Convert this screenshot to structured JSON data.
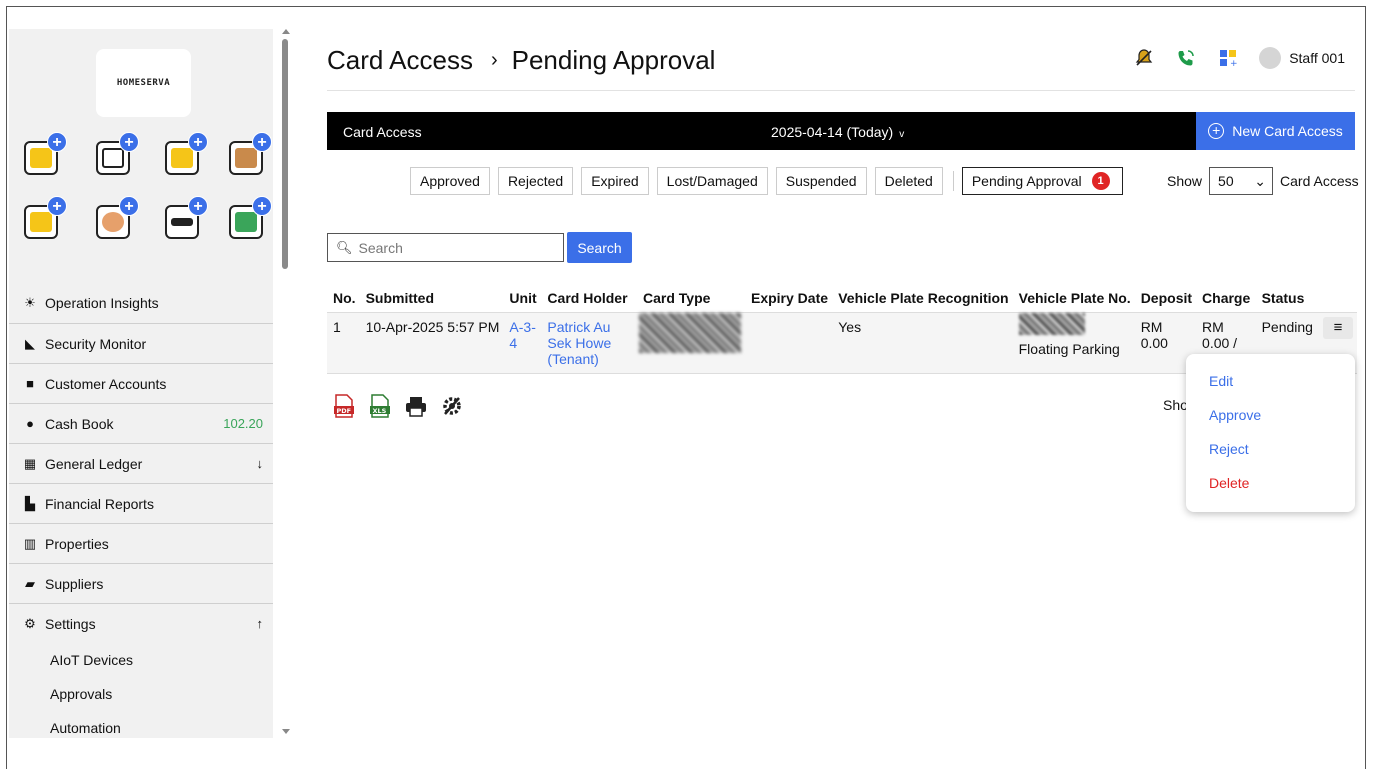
{
  "sidebar": {
    "logo_text": "HOMESERVA",
    "quick_icons": [
      {
        "name": "id-card-add-icon",
        "color": "#f5c518"
      },
      {
        "name": "calendar-add-icon",
        "color": "#222222"
      },
      {
        "name": "bank-add-icon",
        "color": "#f5c518"
      },
      {
        "name": "facilities-add-icon",
        "color": "#8b5a2b"
      },
      {
        "name": "key-card-add-icon",
        "color": "#f5c518"
      },
      {
        "name": "visitor-add-icon",
        "color": "#e6a06b"
      },
      {
        "name": "plate-number-add-icon",
        "color": "#222222"
      },
      {
        "name": "login-card-add-icon",
        "color": "#3aa55a"
      }
    ],
    "nav": [
      {
        "label": "Operation Insights",
        "icon": "lightbulb-icon"
      },
      {
        "label": "Security Monitor",
        "icon": "cctv-icon"
      },
      {
        "label": "Customer Accounts",
        "icon": "user-card-icon"
      },
      {
        "label": "Cash Book",
        "icon": "dollar-icon",
        "right": "102.20"
      },
      {
        "label": "General Ledger",
        "icon": "calculator-icon",
        "right": "↓"
      },
      {
        "label": "Financial Reports",
        "icon": "report-icon"
      },
      {
        "label": "Properties",
        "icon": "building-icon"
      },
      {
        "label": "Suppliers",
        "icon": "truck-icon"
      },
      {
        "label": "Settings",
        "icon": "gear-icon",
        "right": "↑"
      }
    ],
    "sub_nav": [
      "AIoT Devices",
      "Approvals",
      "Automation"
    ]
  },
  "header": {
    "title": "Card Access",
    "separator": "›",
    "subtitle": "Pending Approval",
    "user": "Staff 001"
  },
  "toolbar": {
    "section": "Card Access",
    "date": "2025-04-14 (Today)",
    "date_caret": "v",
    "new_button": "New Card Access",
    "new_button_icon": "+"
  },
  "filters": {
    "tabs": [
      "Approved",
      "Rejected",
      "Expired",
      "Lost/Damaged",
      "Suspended",
      "Deleted"
    ],
    "active": "Pending Approval",
    "badge": "1",
    "show_label": "Show",
    "show_value": "50",
    "show_suffix": "Card Access"
  },
  "search": {
    "placeholder": "Search",
    "button": "Search"
  },
  "table": {
    "columns": [
      "No.",
      "Submitted",
      "Unit",
      "Card Holder",
      "Card Type",
      "Expiry Date",
      "Vehicle Plate Recognition",
      "Vehicle Plate No.",
      "Deposit",
      "Charge",
      "Status"
    ],
    "rows": [
      {
        "no": "1",
        "submitted": "10-Apr-2025 5:57 PM",
        "unit": "A-3-4",
        "holder": "Patrick Au Sek Howe (Tenant)",
        "card_type": "",
        "expiry": "",
        "vpr": "Yes",
        "plate": "Floating Parking",
        "deposit": "RM 0.00",
        "charge": "RM 0.00 / Month",
        "status": "Pending"
      }
    ]
  },
  "row_menu": {
    "items": [
      "Edit",
      "Approve",
      "Reject",
      "Delete"
    ]
  },
  "footer": {
    "show_text": "Sho"
  },
  "colors": {
    "accent": "#3b6fe8",
    "danger": "#e02424",
    "amount": "#3aa55a"
  }
}
